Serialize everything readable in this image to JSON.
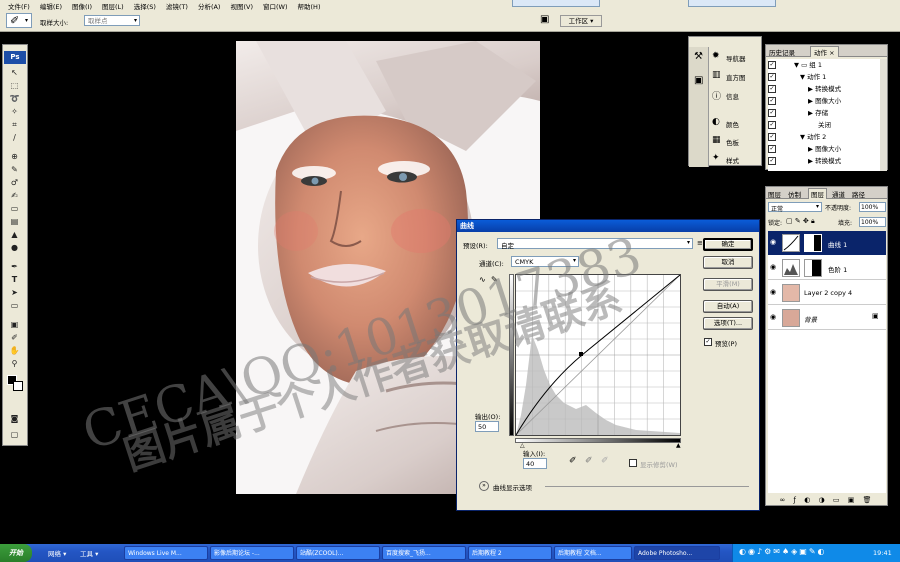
{
  "menubar": {
    "items": [
      "文件(F)",
      "编辑(E)",
      "图像(I)",
      "图层(L)",
      "选择(S)",
      "滤镜(T)",
      "分析(A)",
      "视图(V)",
      "窗口(W)",
      "帮助(H)"
    ]
  },
  "options": {
    "sample_label": "取样大小:",
    "sample_value": "取样点",
    "workspace": "工作区 ▾"
  },
  "toolbox": {
    "logo": "Ps"
  },
  "navigator_panel": {
    "items": [
      {
        "label": "导航器",
        "icon": "navigator-icon"
      },
      {
        "label": "直方图",
        "icon": "histogram-icon"
      },
      {
        "label": "信息",
        "icon": "info-icon"
      },
      {
        "label": "颜色",
        "icon": "color-icon"
      },
      {
        "label": "色板",
        "icon": "swatches-icon"
      },
      {
        "label": "样式",
        "icon": "styles-icon"
      }
    ]
  },
  "history_panel": {
    "tabs": [
      "历史记录",
      "动作 ×"
    ],
    "rows": [
      "组 1",
      "动作 1",
      "转换模式",
      "图像大小",
      "存储",
      "关闭",
      "动作 2",
      "图像大小",
      "转换模式"
    ]
  },
  "layers_panel": {
    "tabs": [
      "图层",
      "仿制",
      "图层",
      "通道",
      "路径"
    ],
    "blend": "正常",
    "opacity_label": "不透明度:",
    "opacity": "100%",
    "lock_label": "锁定:",
    "fill_label": "填充:",
    "fill": "100%",
    "layers": [
      {
        "name": "曲线 1",
        "selected": true
      },
      {
        "name": "色阶 1",
        "selected": false
      },
      {
        "name": "Layer 2 copy 4",
        "selected": false
      },
      {
        "name": "背景",
        "selected": false
      }
    ]
  },
  "curves": {
    "title": "曲线",
    "preset_label": "预设(R):",
    "preset_value": "自定",
    "channel_label": "通道(C):",
    "channel_value": "CMYK",
    "output_label": "输出(O):",
    "output_value": "50",
    "input_label": "输入(I):",
    "input_value": "40",
    "show_clipping": "显示修剪(W)",
    "show_options": "曲线显示选项",
    "preview": "预览(P)",
    "buttons": {
      "ok": "确定",
      "cancel": "取消",
      "smooth": "平滑(M)",
      "auto": "自动(A)",
      "options": "选项(T)..."
    }
  },
  "taskbar": {
    "start": "开始",
    "quick": [
      "网络 ▾",
      "工具 ▾"
    ],
    "tasks": [
      "Windows Live M...",
      "影像后期论坛 -...",
      "站酷(ZCOOL)...",
      "百度搜索_飞扬...",
      "后期教程 2",
      "后期教程 文档...",
      "Adobe Photosho..."
    ],
    "clock": "19:41"
  },
  "watermark": {
    "line1": "CECA\\QQ:1013017383",
    "line2": "图片属于个人作者获取请联系"
  }
}
